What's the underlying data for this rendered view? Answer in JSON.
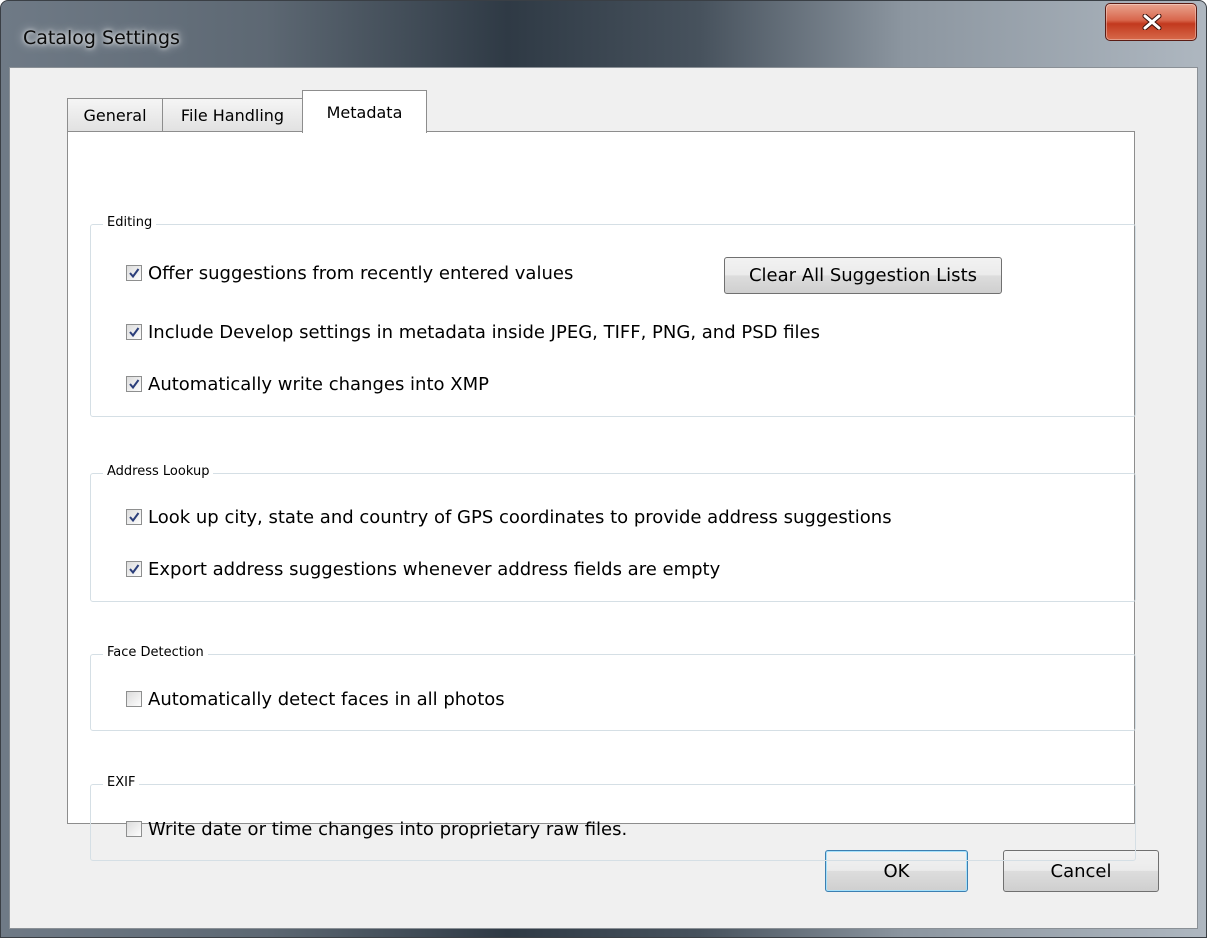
{
  "window": {
    "title": "Catalog Settings",
    "close_icon": "close-x-icon"
  },
  "tabs": [
    {
      "label": "General",
      "selected": false
    },
    {
      "label": "File Handling",
      "selected": false
    },
    {
      "label": "Metadata",
      "selected": true
    }
  ],
  "groups": {
    "editing": {
      "label": "Editing",
      "offer_suggestions": {
        "label": "Offer suggestions from recently entered values",
        "checked": true
      },
      "clear_button": "Clear All Suggestion Lists",
      "include_develop": {
        "label": "Include Develop settings in metadata inside JPEG, TIFF, PNG, and PSD files",
        "checked": true
      },
      "auto_write_xmp": {
        "label": "Automatically write changes into XMP",
        "checked": true
      }
    },
    "address_lookup": {
      "label": "Address Lookup",
      "look_up_city": {
        "label": "Look up city, state and country of GPS coordinates to provide address suggestions",
        "checked": true
      },
      "export_address": {
        "label": "Export address suggestions whenever address fields are empty",
        "checked": true
      }
    },
    "face_detection": {
      "label": "Face Detection",
      "auto_detect_faces": {
        "label": "Automatically detect faces in all photos",
        "checked": false
      }
    },
    "exif": {
      "label": "EXIF",
      "write_date_time": {
        "label": "Write date or time changes into proprietary raw files.",
        "checked": false
      }
    }
  },
  "buttons": {
    "ok": "OK",
    "cancel": "Cancel"
  }
}
